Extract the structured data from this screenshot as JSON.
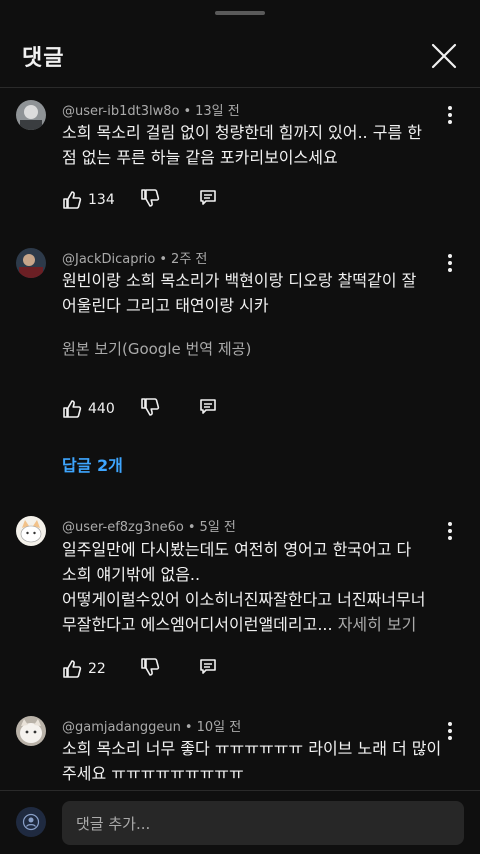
{
  "header": {
    "title": "댓글",
    "close_icon": "close-icon"
  },
  "comments": [
    {
      "author": "@user-ib1dt3lw8o",
      "time": "13일 전",
      "lines": [
        "소희 목소리 걸림 없이 청량한데 힘까지 있어.. 구름 한",
        "점 없는 푸른 하늘 같음 포카리보이스세요"
      ],
      "likes": "134"
    },
    {
      "author": "@JackDicaprio",
      "time": "2주 전",
      "lines": [
        "원빈이랑 소희 목소리가 백현이랑 디오랑 찰떡같이 잘",
        "어울린다 그리고 태연이랑 시카"
      ],
      "translate": "원본 보기(Google 번역 제공)",
      "likes": "440",
      "replies": "답글 2개"
    },
    {
      "author": "@user-ef8zg3ne6o",
      "time": "5일 전",
      "lines": [
        "일주일만에 다시봤는데도 여전히 영어고 한국어고 다",
        "소희 얘기밖에 없음..",
        "어떻게이럴수있어 이소히너진짜잘한다고 너진짜너무너",
        "무잘한다고 에스엠어디서이런앨데리고..."
      ],
      "more": "자세히 보기",
      "likes": "22"
    },
    {
      "author": "@gamjadanggeun",
      "time": "10일 전",
      "lines": [
        "소희 목소리 너무 좋다 ㅠㅠㅠㅠㅠㅠ 라이브 노래 더 많이",
        "주세요 ㅠㅠㅠㅠㅠㅠㅠㅠㅠ"
      ]
    }
  ],
  "composer": {
    "placeholder": "댓글 추가..."
  },
  "colors": {
    "background": "#0f0f0f",
    "text": "#f1f1f1",
    "secondary": "#aaaaaa",
    "link": "#3ea6ff",
    "input": "#272727"
  }
}
